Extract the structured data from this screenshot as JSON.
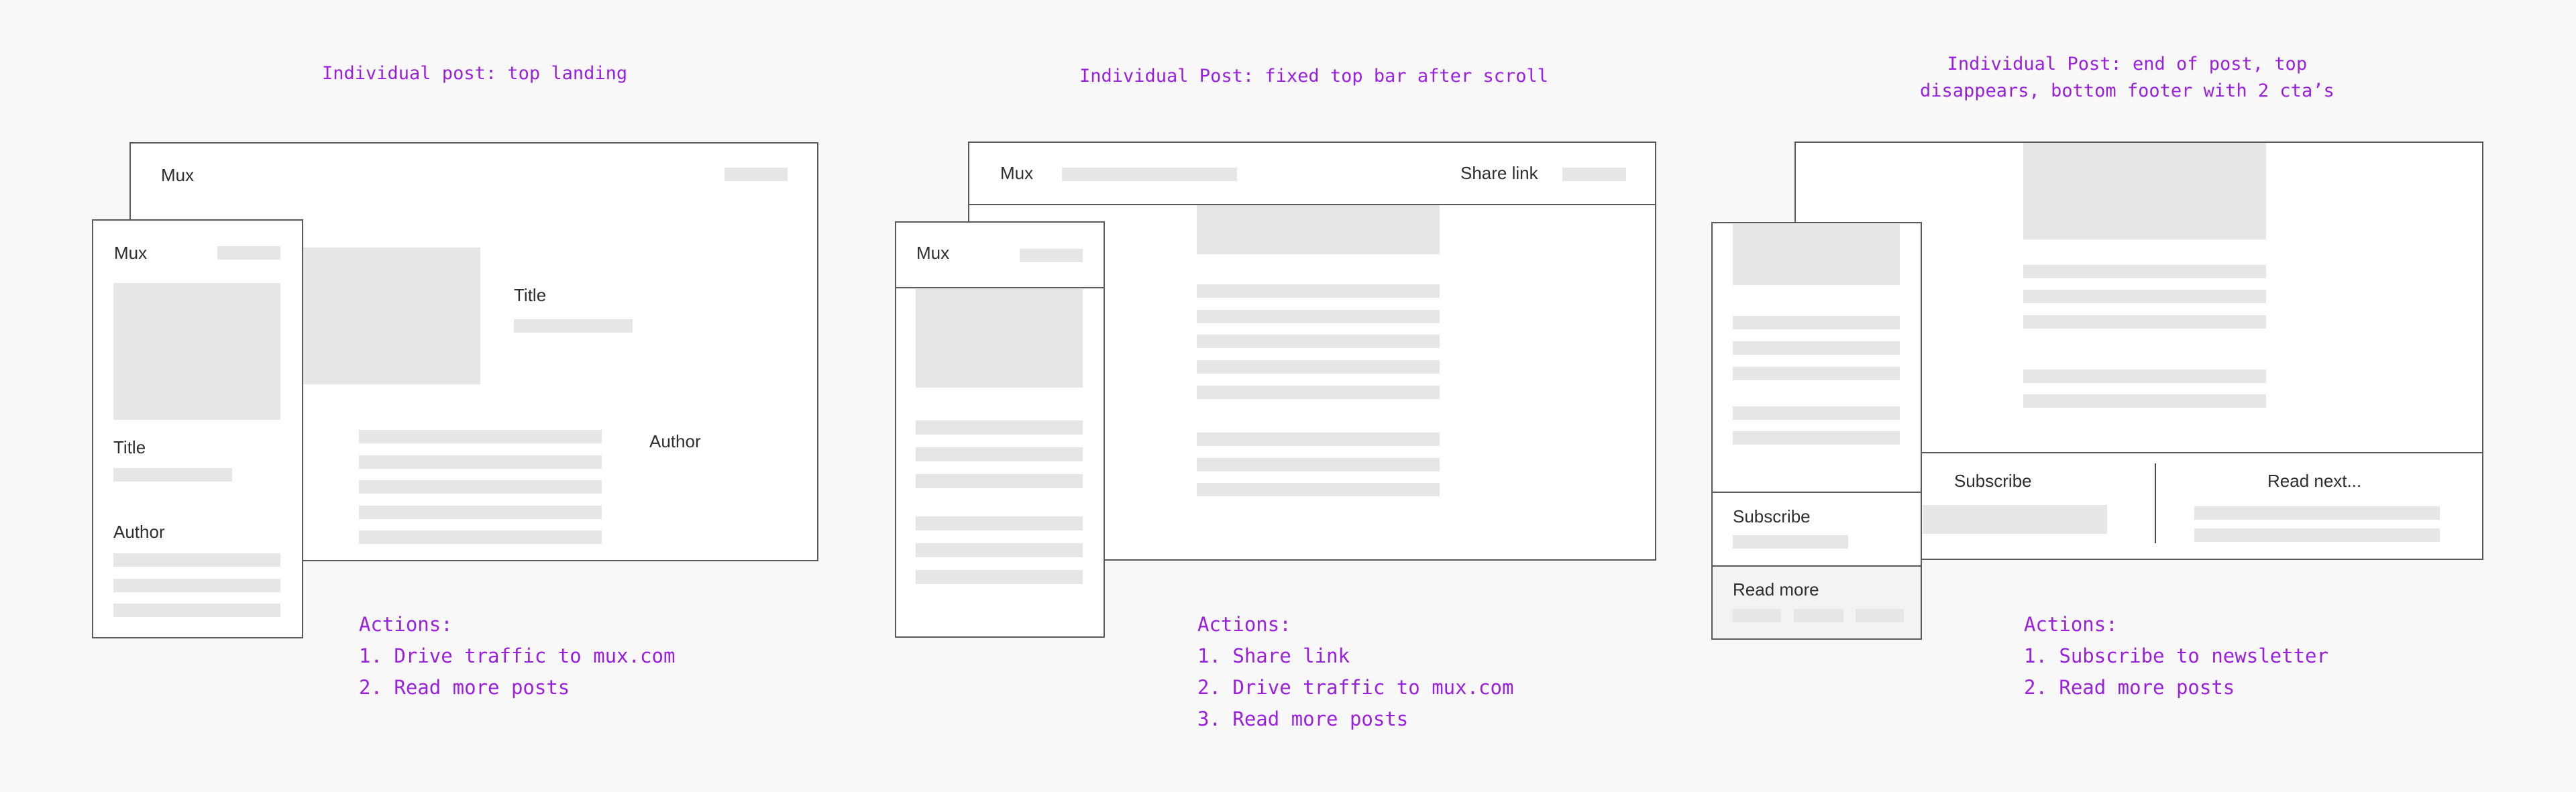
{
  "colors": {
    "annotation": "#9b1fe0",
    "frame_border": "#5a5a5a",
    "placeholder": "#e6e6e6",
    "background": "#f8f8f8"
  },
  "panels": [
    {
      "caption": "Individual post: top landing",
      "desktop": {
        "logo": "Mux",
        "title": "Title",
        "author": "Author"
      },
      "mobile": {
        "logo": "Mux",
        "title": "Title",
        "author": "Author"
      },
      "actions": {
        "heading": "Actions:",
        "items": [
          "1. Drive traffic to mux.com",
          "2. Read more posts"
        ]
      }
    },
    {
      "caption": "Individual Post: fixed top bar after scroll",
      "desktop": {
        "logo": "Mux",
        "share_link": "Share link"
      },
      "mobile": {
        "logo": "Mux"
      },
      "actions": {
        "heading": "Actions:",
        "items": [
          "1. Share link",
          "2. Drive traffic to mux.com",
          "3. Read more posts"
        ]
      }
    },
    {
      "caption_lines": [
        "Individual Post: end of post, top",
        "disappears, bottom footer with 2 cta’s"
      ],
      "desktop": {
        "subscribe": "Subscribe",
        "read_next": "Read next..."
      },
      "mobile": {
        "subscribe": "Subscribe",
        "read_more": "Read more"
      },
      "actions": {
        "heading": "Actions:",
        "items": [
          "1. Subscribe to newsletter",
          "2. Read more posts"
        ]
      }
    }
  ]
}
